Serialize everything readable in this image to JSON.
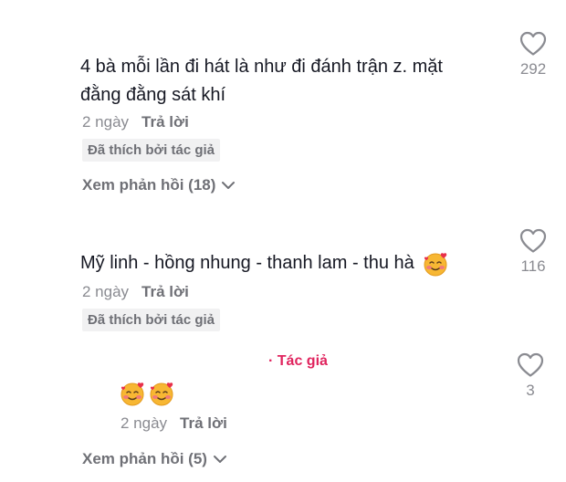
{
  "comments": [
    {
      "text_line1": "4 bà mỗi lần đi hát là như đi đánh trận z. mặt",
      "text_line2": "đằng đằng sát khí",
      "time": "2 ngày",
      "reply_label": "Trả lời",
      "badge": "Đã thích bởi tác giả",
      "likes": "292",
      "view_replies": "Xem phản hồi (18)"
    },
    {
      "text": "Mỹ linh - hồng nhung - thanh lam - thu hà",
      "time": "2 ngày",
      "reply_label": "Trả lời",
      "badge": "Đã thích bởi tác giả",
      "likes": "116"
    }
  ],
  "reply": {
    "author_tag": "Tác giả",
    "time": "2 ngày",
    "reply_label": "Trả lời",
    "likes": "3"
  },
  "view_replies_2": "Xem phản hồi (5)",
  "icons": {
    "heart": "heart-outline-icon",
    "emoji": "smiling-face-with-hearts-icon",
    "chevron": "chevron-down-icon"
  }
}
